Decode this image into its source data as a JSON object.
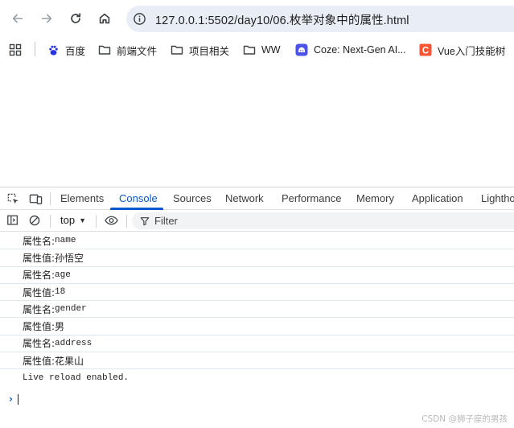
{
  "browser": {
    "url": "127.0.0.1:5502/day10/06.枚举对象中的属性.html"
  },
  "bookmarks": [
    {
      "label": "百度",
      "icon": "baidu-paw-icon"
    },
    {
      "label": "前端文件",
      "icon": "folder-icon"
    },
    {
      "label": "项目相关",
      "icon": "folder-icon"
    },
    {
      "label": "WW",
      "icon": "folder-icon"
    },
    {
      "label": "Coze: Next-Gen AI...",
      "icon": "coze-icon"
    },
    {
      "label": "Vue入门技能树",
      "icon": "csdn-c-icon"
    }
  ],
  "devtools": {
    "tabs": [
      "Elements",
      "Console",
      "Sources",
      "Network",
      "Performance",
      "Memory",
      "Application",
      "Lightho"
    ],
    "active_tab": "Console",
    "context": "top",
    "filter_placeholder": "Filter",
    "accent_color": "#0b57d0"
  },
  "console": {
    "rows": [
      {
        "label": "属性名:",
        "value": "name"
      },
      {
        "label": "属性值:",
        "value": "孙悟空"
      },
      {
        "label": "属性名:",
        "value": "age"
      },
      {
        "label": "属性值:",
        "value": "18"
      },
      {
        "label": "属性名:",
        "value": "gender"
      },
      {
        "label": "属性值:",
        "value": "男"
      },
      {
        "label": "属性名:",
        "value": "address"
      },
      {
        "label": "属性值:",
        "value": "花果山"
      }
    ],
    "live_reload": "Live reload enabled."
  },
  "watermark": "CSDN @狮子座的男孩"
}
